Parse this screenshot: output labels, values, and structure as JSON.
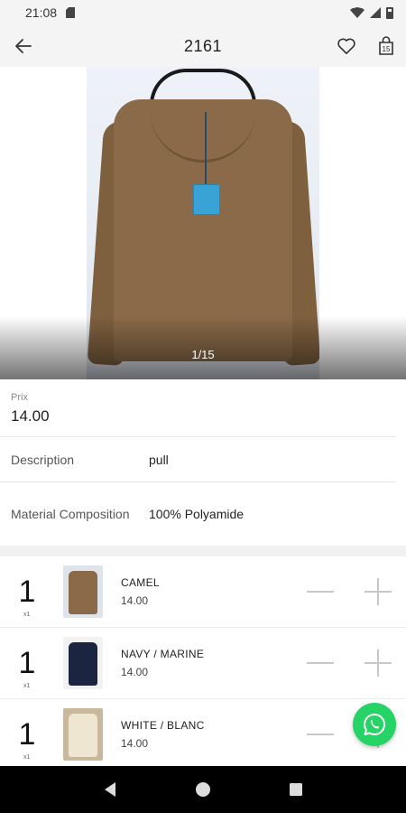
{
  "status_bar": {
    "time": "21:08"
  },
  "app_bar": {
    "title": "2161",
    "bag_count": "15"
  },
  "gallery": {
    "counter": "1/15"
  },
  "price": {
    "label": "Prix",
    "value": "14.00"
  },
  "info": [
    {
      "label": "Description",
      "value": "pull"
    },
    {
      "label": "Material Composition",
      "value": "100% Polyamide"
    }
  ],
  "variants": [
    {
      "qty": "1",
      "multiplier": "x1",
      "name": "CAMEL",
      "price": "14.00",
      "color": "#8a6a48"
    },
    {
      "qty": "1",
      "multiplier": "x1",
      "name": "NAVY / MARINE",
      "price": "14.00",
      "color": "#1c2540"
    },
    {
      "qty": "1",
      "multiplier": "x1",
      "name": "WHITE / BLANC",
      "price": "14.00",
      "color": "#e8dcc4"
    }
  ],
  "colors": {
    "whatsapp": "#25d366",
    "app_bar_bg": "#f4f4f4"
  }
}
